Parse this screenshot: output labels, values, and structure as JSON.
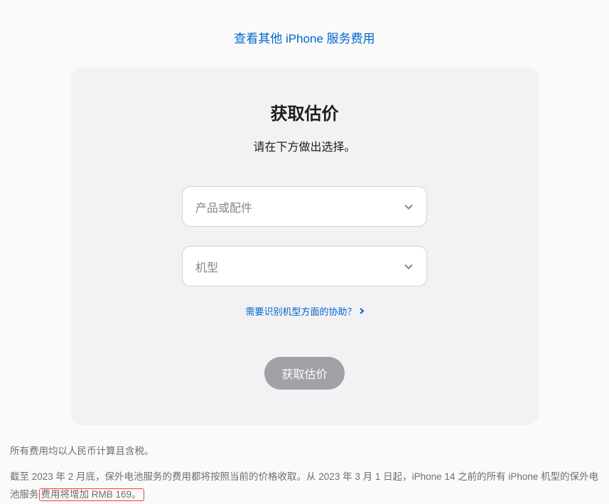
{
  "topLink": {
    "label": "查看其他 iPhone 服务费用"
  },
  "card": {
    "title": "获取估价",
    "subtitle": "请在下方做出选择。",
    "productSelect": {
      "placeholder": "产品或配件"
    },
    "modelSelect": {
      "placeholder": "机型"
    },
    "helpLink": {
      "label": "需要识别机型方面的协助？"
    },
    "submitButton": {
      "label": "获取估价"
    }
  },
  "footer": {
    "line1": "所有费用均以人民币计算且含税。",
    "line2_part1": "截至 2023 年 2 月底，保外电池服务的费用都将按照当前的价格收取。从 2023 年 3 月 1 日起，iPhone 14 之前的所有 iPhone 机型的保外电池服务",
    "line2_highlight": "费用将增加 RMB 169。"
  }
}
